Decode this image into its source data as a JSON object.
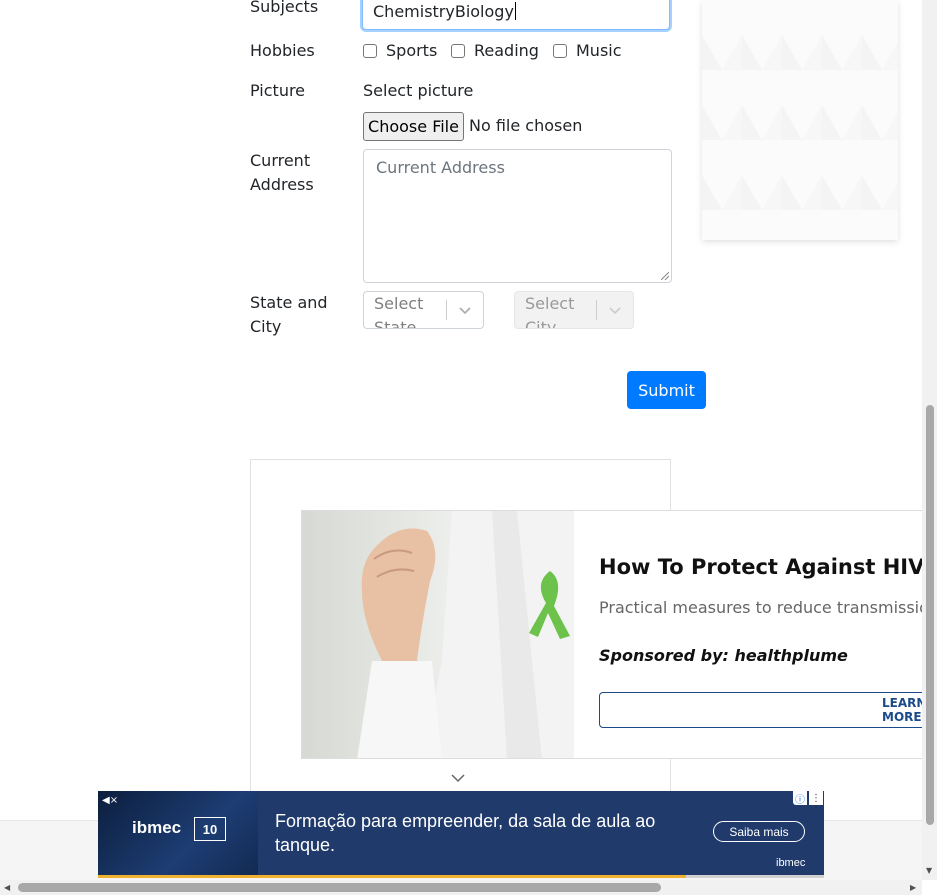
{
  "form": {
    "subjects_label": "Subjects",
    "subjects_value": "ChemistryBiology",
    "hobbies_label": "Hobbies",
    "hobbies": [
      {
        "label": "Sports",
        "checked": false
      },
      {
        "label": "Reading",
        "checked": false
      },
      {
        "label": "Music",
        "checked": false
      }
    ],
    "picture_label": "Picture",
    "select_picture_label": "Select picture",
    "choose_file_label": "Choose File",
    "no_file_text": "No file chosen",
    "current_address_label_line1": "Current",
    "current_address_label_line2": "Address",
    "current_address_placeholder": "Current Address",
    "state_city_label_line1": "State and",
    "state_city_label_line2": "City",
    "state_placeholder": "Select State",
    "city_placeholder": "Select City",
    "submit_label": "Submit"
  },
  "ad": {
    "title": "How To Protect Against HIV",
    "description": "Practical measures to reduce transmission",
    "sponsor": "Sponsored by: healthplume",
    "cta": "LEARN MORE"
  },
  "banner": {
    "text": "Formação para empreender, da sala de aula ao tanque.",
    "cta": "Saiba mais",
    "brand": "ibmec",
    "brand_small": "ibmec",
    "badge": "10"
  },
  "colors": {
    "primary": "#007bff",
    "banner_bg": "#1f3a6b",
    "ad_cta": "#1a4a8a",
    "ribbon_green": "#6cc24a"
  }
}
